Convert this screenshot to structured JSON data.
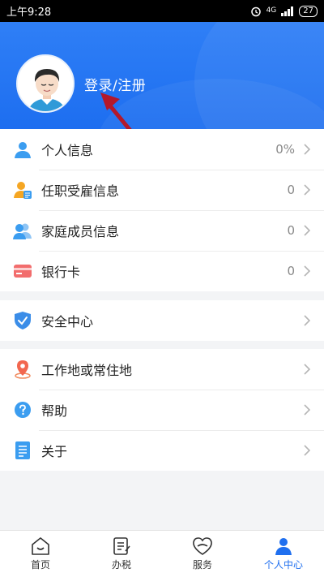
{
  "status_bar": {
    "time": "上午9:28",
    "network": "4G",
    "battery": "27"
  },
  "header": {
    "login_text": "登录/注册"
  },
  "menu_group_1": [
    {
      "label": "个人信息",
      "value": "0%",
      "icon": "person-icon"
    },
    {
      "label": "任职受雇信息",
      "value": "0",
      "icon": "employment-icon"
    },
    {
      "label": "家庭成员信息",
      "value": "0",
      "icon": "family-icon"
    },
    {
      "label": "银行卡",
      "value": "0",
      "icon": "bank-card-icon"
    }
  ],
  "menu_group_2": [
    {
      "label": "安全中心",
      "icon": "shield-icon"
    }
  ],
  "menu_group_3": [
    {
      "label": "工作地或常住地",
      "icon": "location-icon"
    },
    {
      "label": "帮助",
      "icon": "help-icon"
    },
    {
      "label": "关于",
      "icon": "document-icon"
    }
  ],
  "tabs": [
    {
      "label": "首页",
      "icon": "home-icon"
    },
    {
      "label": "办税",
      "icon": "tax-icon"
    },
    {
      "label": "服务",
      "icon": "service-icon"
    },
    {
      "label": "个人中心",
      "icon": "profile-icon",
      "active": true
    }
  ],
  "colors": {
    "brand": "#1f6fef",
    "header": "#2f7ff6",
    "background": "#f3f4f6"
  }
}
